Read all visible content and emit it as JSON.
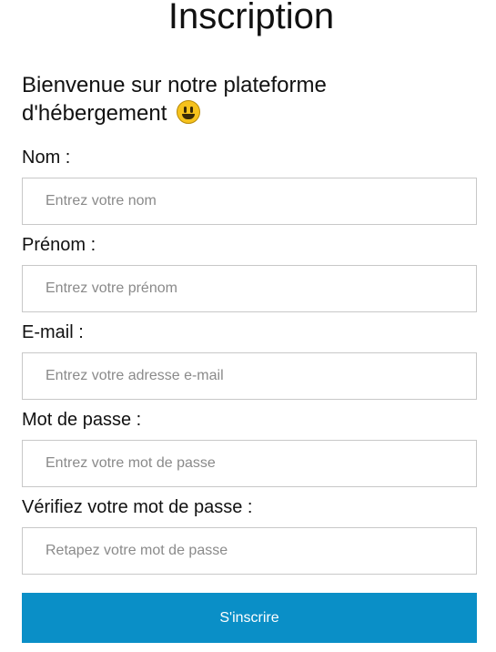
{
  "page_title": "Inscription",
  "welcome_text": "Bienvenue sur notre plateforme d'hébergement",
  "welcome_emoji": "grinning-face-emoji",
  "form": {
    "fields": [
      {
        "label": "Nom :",
        "placeholder": "Entrez votre nom",
        "value": ""
      },
      {
        "label": "Prénom :",
        "placeholder": "Entrez votre prénom",
        "value": ""
      },
      {
        "label": "E-mail :",
        "placeholder": "Entrez votre adresse e-mail",
        "value": ""
      },
      {
        "label": "Mot de passe :",
        "placeholder": "Entrez votre mot de passe",
        "value": ""
      },
      {
        "label": "Vérifiez votre mot de passe :",
        "placeholder": "Retapez votre mot de passe",
        "value": ""
      }
    ],
    "submit_label": "S'inscrire"
  },
  "colors": {
    "submit_background": "#0a8fc7",
    "submit_text": "#ffffff",
    "field_border": "#c8c8c8",
    "placeholder": "#8a8a8a"
  }
}
